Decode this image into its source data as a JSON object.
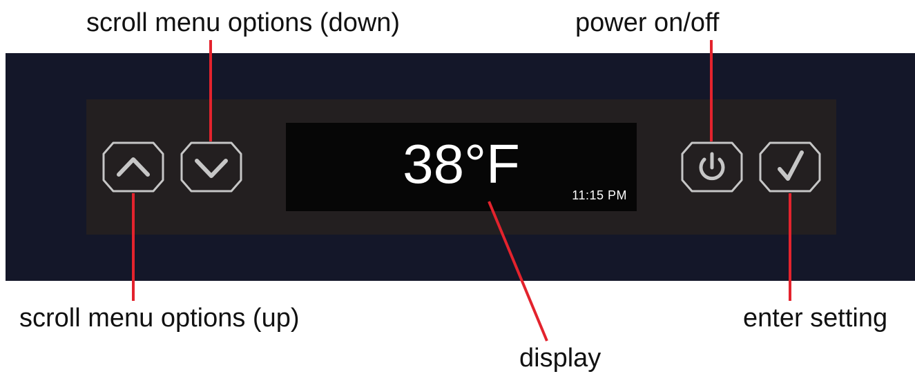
{
  "labels": {
    "scroll_down": "scroll menu options (down)",
    "power": "power on/off",
    "scroll_up": "scroll menu options (up)",
    "enter": "enter setting",
    "display": "display"
  },
  "display": {
    "temperature": "38°F",
    "time": "11:15 PM"
  },
  "buttons": [
    {
      "id": "up",
      "icon": "chevron-up-icon"
    },
    {
      "id": "down",
      "icon": "chevron-down-icon"
    },
    {
      "id": "power",
      "icon": "power-icon"
    },
    {
      "id": "enter",
      "icon": "checkmark-icon"
    }
  ],
  "colors": {
    "band": "#141729",
    "panel": "#231f20",
    "screen": "#060606",
    "leader": "#e3232d",
    "button_outline": "#c6c6c6",
    "text": "#111111"
  }
}
